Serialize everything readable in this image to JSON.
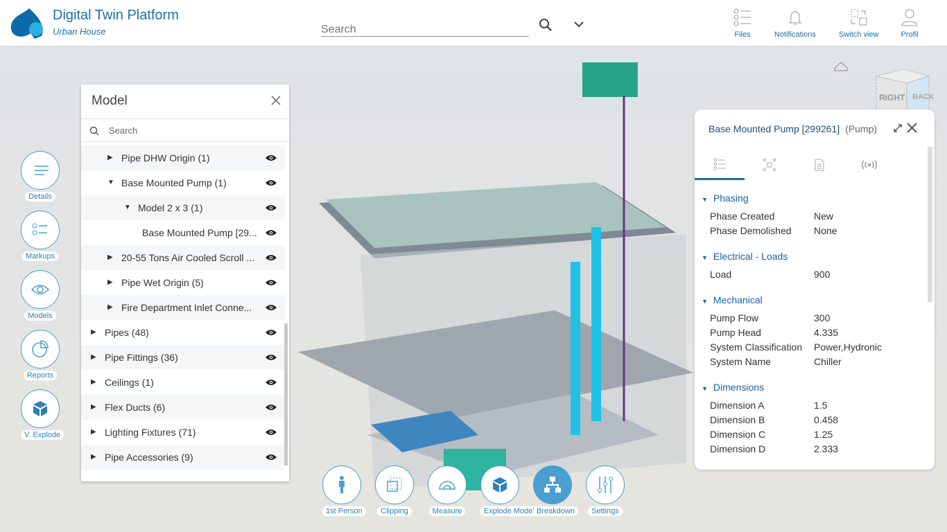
{
  "header": {
    "title": "Digital Twin Platform",
    "subtitle": "Urban House",
    "search_placeholder": "Search",
    "buttons": [
      {
        "label": "Files",
        "icon": "list-icon"
      },
      {
        "label": "Notifications",
        "icon": "bell-icon"
      },
      {
        "label": "Switch view",
        "icon": "switch-view-icon"
      },
      {
        "label": "Profil",
        "icon": "user-icon"
      }
    ]
  },
  "left_toolbar": [
    {
      "label": "Details",
      "icon": "details-icon"
    },
    {
      "label": "Markups",
      "icon": "markups-icon"
    },
    {
      "label": "Models",
      "icon": "eye-icon"
    },
    {
      "label": "Reports",
      "icon": "pie-chart-icon"
    },
    {
      "label": "V. Explode",
      "icon": "cube-icon"
    }
  ],
  "model_panel": {
    "title": "Model",
    "search_placeholder": "Search",
    "items": [
      {
        "label": "Pipe DHW Origin (1)",
        "level": 1,
        "expanded": false
      },
      {
        "label": "Base Mounted Pump (1)",
        "level": 1,
        "expanded": true
      },
      {
        "label": "Model 2 x 3 (1)",
        "level": 2,
        "expanded": true
      },
      {
        "label": "Base Mounted Pump [29...",
        "level": 3,
        "expanded": null
      },
      {
        "label": "20-55 Tons Air Cooled Scroll ...",
        "level": 1,
        "expanded": false
      },
      {
        "label": "Pipe Wet Origin (5)",
        "level": 1,
        "expanded": false
      },
      {
        "label": "Fire Department Inlet Conne...",
        "level": 1,
        "expanded": false
      },
      {
        "label": "Pipes (48)",
        "level": 0,
        "expanded": false
      },
      {
        "label": "Pipe Fittings (36)",
        "level": 0,
        "expanded": false
      },
      {
        "label": "Ceilings (1)",
        "level": 0,
        "expanded": false
      },
      {
        "label": "Flex Ducts (6)",
        "level": 0,
        "expanded": false
      },
      {
        "label": "Lighting Fixtures (71)",
        "level": 0,
        "expanded": false
      },
      {
        "label": "Pipe Accessories (9)",
        "level": 0,
        "expanded": false
      }
    ]
  },
  "properties": {
    "title": "Base Mounted Pump [299261]",
    "type": "(Pump)",
    "tabs": [
      "properties-list-icon",
      "network-icon",
      "document-icon",
      "signal-icon"
    ],
    "sections": [
      {
        "name": "Phasing",
        "rows": [
          [
            "Phase Created",
            "New"
          ],
          [
            "Phase Demolished",
            "None"
          ]
        ]
      },
      {
        "name": "Electrical - Loads",
        "rows": [
          [
            "Load",
            "900"
          ]
        ]
      },
      {
        "name": "Mechanical",
        "rows": [
          [
            "Pump Flow",
            "300"
          ],
          [
            "Pump Head",
            "4.335"
          ],
          [
            "System Classification",
            "Power,Hydronic"
          ],
          [
            "System Name",
            "Chiller"
          ]
        ]
      },
      {
        "name": "Dimensions",
        "rows": [
          [
            "Dimension A",
            "1.5"
          ],
          [
            "Dimension B",
            "0.458"
          ],
          [
            "Dimension C",
            "1.25"
          ],
          [
            "Dimension D",
            "2.333"
          ]
        ]
      }
    ]
  },
  "view_cube": {
    "right": "RIGHT",
    "back": "BACK"
  },
  "bottom_toolbar": [
    {
      "label": "1st Person",
      "icon": "person-icon"
    },
    {
      "label": "Clipping",
      "icon": "clipping-icon"
    },
    {
      "label": "Measure",
      "icon": "protractor-icon"
    },
    {
      "label": "Explode Model",
      "icon": "cube-icon"
    },
    {
      "label": "Breakdown",
      "icon": "hierarchy-icon",
      "active": true
    },
    {
      "label": "Settings",
      "icon": "sliders-icon"
    }
  ],
  "colors": {
    "accent": "#1c6fae",
    "active": "#4a9fd0"
  }
}
